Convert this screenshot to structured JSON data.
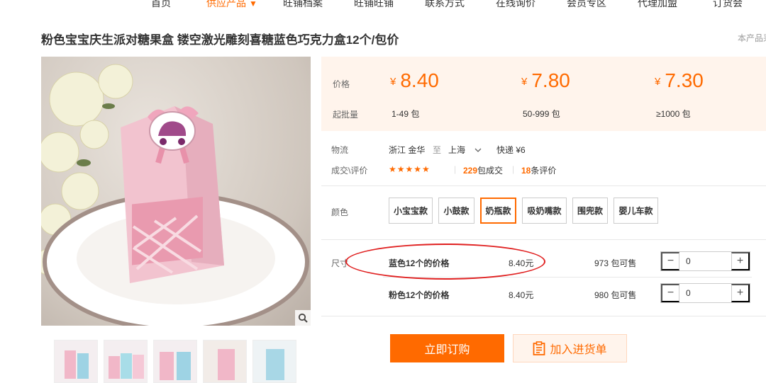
{
  "nav": {
    "items": [
      {
        "label": "首页"
      },
      {
        "label": "供应产品",
        "caret": "▼"
      },
      {
        "label": "旺铺档案"
      },
      {
        "label": "旺铺旺铺"
      },
      {
        "label": "联系方式"
      },
      {
        "label": "在线询价"
      },
      {
        "label": "会员专区"
      },
      {
        "label": "代理加盟"
      },
      {
        "label": "订货会"
      }
    ]
  },
  "product": {
    "title": "粉色宝宝庆生派对糖果盒 镂空激光雕刻喜糖蓝色巧克力盒12个/包价",
    "notice": "本产品采"
  },
  "pricing": {
    "price_label": "价格",
    "qty_label": "起批量",
    "currency": "¥",
    "tiers": [
      {
        "price": "8.40",
        "qty": "1-49 包"
      },
      {
        "price": "7.80",
        "qty": "50-999 包"
      },
      {
        "price": "7.30",
        "qty": "≥1000 包"
      }
    ]
  },
  "logistics": {
    "label": "物流",
    "from": "浙江 金华",
    "to_word": "至",
    "to": "上海",
    "shipping": "快递 ¥6"
  },
  "reviews": {
    "label": "成交\\评价",
    "stars": "★★★★★",
    "deals_count": "229",
    "deals_suffix": "包成交",
    "review_count": "18",
    "review_suffix": "条评价"
  },
  "colors": {
    "label": "颜色",
    "options": [
      "小宝宝款",
      "小鼓款",
      "奶瓶款",
      "吸奶嘴款",
      "围兜款",
      "婴儿车款"
    ],
    "selected": "奶瓶款"
  },
  "sizes": {
    "label": "尺寸",
    "rows": [
      {
        "name": "蓝色12个的价格",
        "price": "8.40元",
        "stock": "973 包可售",
        "quantity": "0"
      },
      {
        "name": "粉色12个的价格",
        "price": "8.40元",
        "stock": "980 包可售",
        "quantity": "0"
      }
    ]
  },
  "stepper": {
    "minus": "−",
    "plus": "+"
  },
  "actions": {
    "buy_now": "立即订购",
    "add_to_cart": "加入进货单"
  },
  "colors_theme": {
    "accent": "#ff6a00",
    "price_panel_bg": "#fff4ec",
    "annotation_red": "#e02020"
  }
}
